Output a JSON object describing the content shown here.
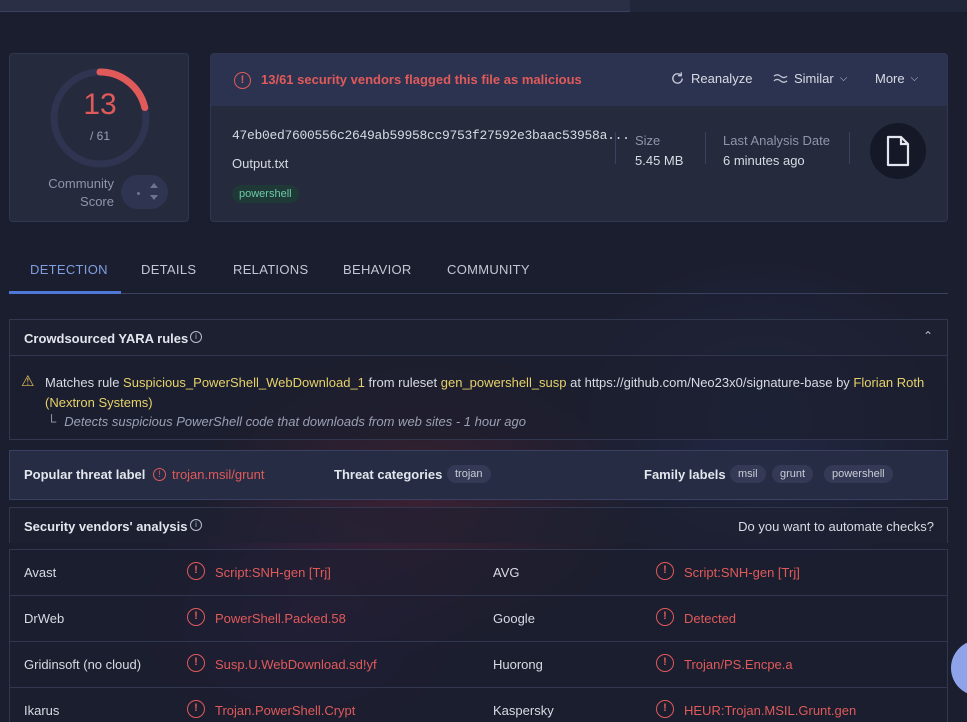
{
  "score": {
    "detected": "13",
    "total": "/ 61",
    "detected_fraction": 0.213,
    "community_label_1": "Community",
    "community_label_2": "Score",
    "ring_color": "#e05a5a",
    "ring_track_color": "#2f3550"
  },
  "summary": {
    "alert": "13/61 security vendors flagged this file as malicious",
    "reanalyze": "Reanalyze",
    "similar": "Similar",
    "more": "More",
    "hash": "47eb0ed7600556c2649ab59958cc9753f27592e3baac53958a...",
    "filename": "Output.txt",
    "tag": "powershell",
    "size_label": "Size",
    "size_value": "5.45 MB",
    "date_label": "Last Analysis Date",
    "date_value": "6 minutes ago"
  },
  "tabs": [
    {
      "label": "DETECTION"
    },
    {
      "label": "DETAILS"
    },
    {
      "label": "RELATIONS"
    },
    {
      "label": "BEHAVIOR"
    },
    {
      "label": "COMMUNITY"
    }
  ],
  "yara": {
    "title": "Crowdsourced YARA rules",
    "prefix": "Matches rule ",
    "rule": "Suspicious_PowerShell_WebDownload_1",
    "from": " from ruleset ",
    "ruleset": "gen_powershell_susp",
    "at": " at https://github.com/Neo23x0/signature-base by ",
    "author": "Florian Roth (Nextron Systems)",
    "description": "Detects suspicious PowerShell code that downloads from web sites - 1 hour ago"
  },
  "threat": {
    "popular_label": "Popular threat label",
    "popular_value": "trojan.msil/grunt",
    "categories_label": "Threat categories",
    "categories": [
      "trojan"
    ],
    "family_label": "Family labels",
    "families": [
      "msil",
      "grunt",
      "powershell"
    ]
  },
  "vendors": {
    "title": "Security vendors' analysis",
    "automate": "Do you want to automate checks?",
    "rows": [
      {
        "left_name": "Avast",
        "left_result": "Script:SNH-gen [Trj]",
        "right_name": "AVG",
        "right_result": "Script:SNH-gen [Trj]"
      },
      {
        "left_name": "DrWeb",
        "left_result": "PowerShell.Packed.58",
        "right_name": "Google",
        "right_result": "Detected"
      },
      {
        "left_name": "Gridinsoft (no cloud)",
        "left_result": "Susp.U.WebDownload.sd!yf",
        "right_name": "Huorong",
        "right_result": "Trojan/PS.Encpe.a"
      },
      {
        "left_name": "Ikarus",
        "left_result": "Trojan.PowerShell.Crypt",
        "right_name": "Kaspersky",
        "right_result": "HEUR:Trojan.MSIL.Grunt.gen"
      }
    ]
  },
  "colors": {
    "malicious": "#e05a5a",
    "accent": "#4f77d6",
    "highlight": "#e6d26a"
  },
  "icons": {
    "alert": "alert-circle-icon",
    "reanalyze": "refresh-icon",
    "similar": "similar-icon",
    "file": "file-icon",
    "warning": "warning-icon",
    "info": "info-icon"
  }
}
